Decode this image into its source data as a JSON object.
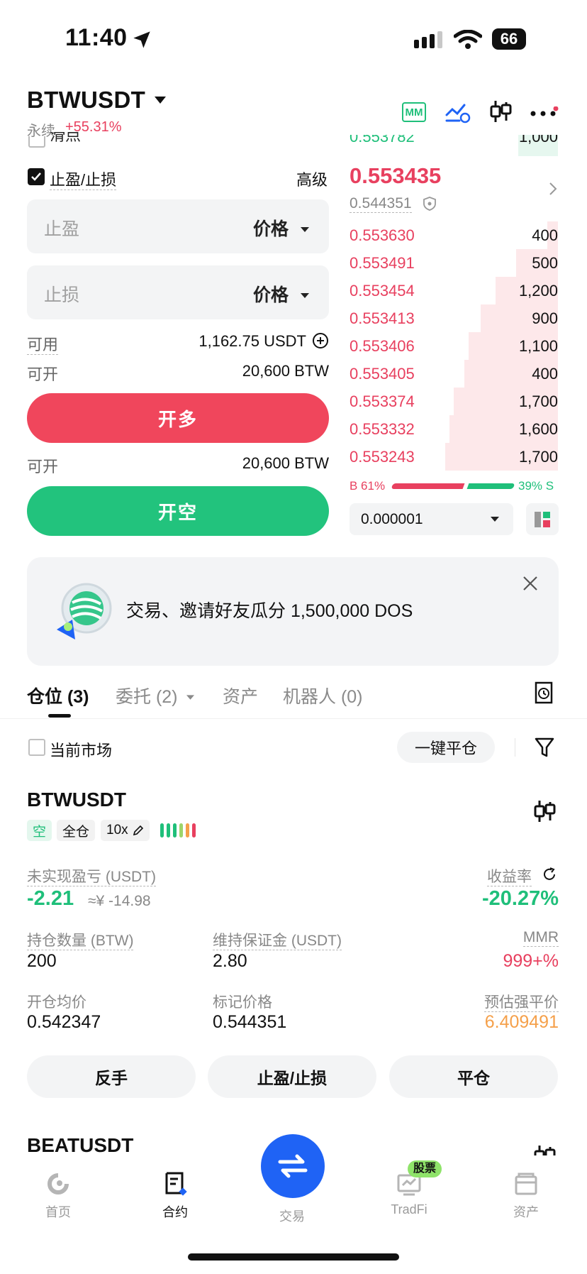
{
  "status_bar": {
    "time": "11:40",
    "battery": "66"
  },
  "header": {
    "symbol": "BTWUSDT",
    "contract_type": "永续",
    "change_pct": "+55.31%",
    "mm_badge": "MM"
  },
  "order_form": {
    "hidden_option_partial": "滑点",
    "tp_sl_label": "止盈/止损",
    "tp_sl_checked": true,
    "advanced_label": "高级",
    "take_profit_placeholder": "止盈",
    "stop_loss_placeholder": "止损",
    "price_type_label": "价格",
    "available_label": "可用",
    "available_value": "1,162.75 USDT",
    "can_open_label": "可开",
    "can_open_long_value": "20,600 BTW",
    "long_button": "开多",
    "can_open_short_value": "20,600 BTW",
    "short_button": "开空"
  },
  "order_book": {
    "top_partial_price": "0.553782",
    "top_partial_qty": "1,000",
    "last_price": "0.553435",
    "mark_price": "0.544351",
    "asks": [
      {
        "price": "0.553630",
        "qty": "400",
        "depth": 0.05
      },
      {
        "price": "0.553491",
        "qty": "500",
        "depth": 0.2
      },
      {
        "price": "0.553454",
        "qty": "1,200",
        "depth": 0.3
      },
      {
        "price": "0.553413",
        "qty": "900",
        "depth": 0.37
      },
      {
        "price": "0.553406",
        "qty": "1,100",
        "depth": 0.43
      },
      {
        "price": "0.553405",
        "qty": "400",
        "depth": 0.45
      },
      {
        "price": "0.553374",
        "qty": "1,700",
        "depth": 0.5
      },
      {
        "price": "0.553332",
        "qty": "1,600",
        "depth": 0.52
      },
      {
        "price": "0.553243",
        "qty": "1,700",
        "depth": 0.54
      }
    ],
    "buy_ratio_label": "B 61%",
    "sell_ratio_label": "39% S",
    "buy_ratio": 0.61,
    "precision_value": "0.000001"
  },
  "banner": {
    "text": "交易、邀请好友瓜分 1,500,000 DOS"
  },
  "tabs": [
    {
      "label": "仓位 (3)",
      "active": true
    },
    {
      "label": "委托 (2)",
      "active": false
    },
    {
      "label": "资产",
      "active": false
    },
    {
      "label": "机器人 (0)",
      "active": false
    }
  ],
  "filter": {
    "current_market_label": "当前市场",
    "close_all_button": "一键平仓"
  },
  "position": {
    "symbol": "BTWUSDT",
    "side_tag": "空",
    "margin_tag": "全仓",
    "leverage_tag": "10x",
    "unrealized_pnl_label": "未实现盈亏 (USDT)",
    "unrealized_pnl_value": "-2.21",
    "unrealized_pnl_cny": "≈¥ -14.98",
    "roi_label": "收益率",
    "roi_value": "-20.27%",
    "size_label": "持仓数量 (BTW)",
    "size_value": "200",
    "maint_margin_label": "维持保证金 (USDT)",
    "maint_margin_value": "2.80",
    "mmr_label": "MMR",
    "mmr_value": "999+%",
    "entry_price_label": "开仓均价",
    "entry_price_value": "0.542347",
    "mark_price_label": "标记价格",
    "mark_price_value": "0.544351",
    "liq_price_label": "预估强平价",
    "liq_price_value": "6.409491",
    "reverse_button": "反手",
    "tpsl_button": "止盈/止损",
    "close_button": "平仓"
  },
  "next_position": {
    "symbol": "BEATUSDT"
  },
  "bottom_nav": {
    "items": [
      "首页",
      "合约",
      "交易",
      "TradFi",
      "资产"
    ],
    "tradfi_badge": "股票"
  },
  "colors": {
    "red": "#e8405f",
    "green": "#1fbf7a",
    "orange": "#f5a04a",
    "blue": "#1f63f5"
  }
}
